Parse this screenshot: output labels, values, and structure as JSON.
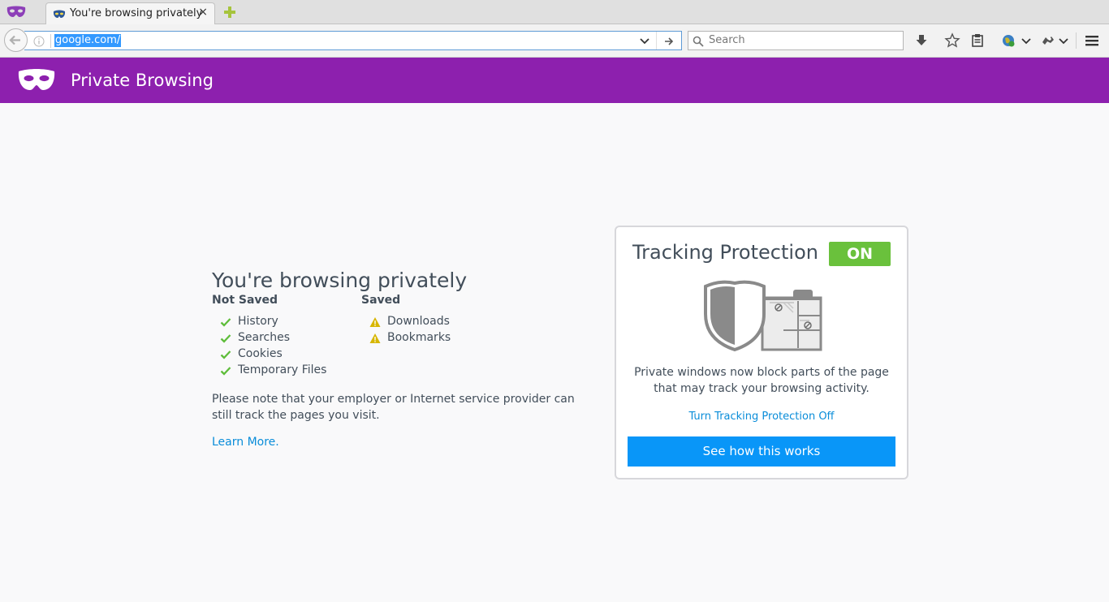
{
  "tab": {
    "title": "You're browsing privately",
    "close": "×"
  },
  "navbar": {
    "url": "google.com/",
    "search_placeholder": "Search"
  },
  "header": {
    "title": "Private Browsing"
  },
  "main": {
    "heading": "You're browsing privately",
    "not_saved": {
      "heading": "Not Saved",
      "items": [
        "History",
        "Searches",
        "Cookies",
        "Temporary Files"
      ]
    },
    "saved": {
      "heading": "Saved",
      "items": [
        "Downloads",
        "Bookmarks"
      ]
    },
    "note": "Please note that your employer or Internet service provider can still track the pages you visit.",
    "learn_more": "Learn More."
  },
  "tracking": {
    "title": "Tracking Protection",
    "status": "ON",
    "description": "Private windows now block parts of the page that may track your browsing activity.",
    "turn_off_link": "Turn Tracking Protection Off",
    "button": "See how this works"
  },
  "colors": {
    "header_purple": "#8d20ae",
    "toggle_green": "#6ac13c",
    "link_blue": "#0a8dd9",
    "button_blue": "#0996f8",
    "check_green": "#5ebd3a",
    "warning_yellow": "#d7b600"
  }
}
